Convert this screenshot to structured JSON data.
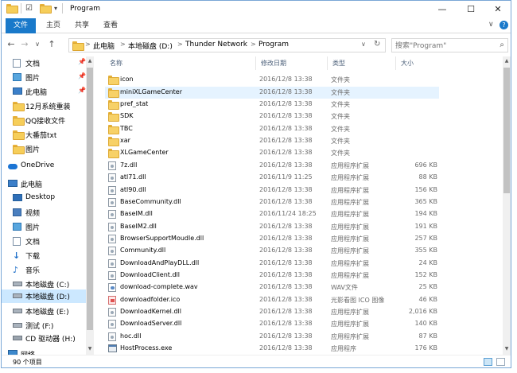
{
  "window": {
    "title": "Program",
    "controls": {
      "minimize": "—",
      "maximize": "☐",
      "close": "✕"
    }
  },
  "ribbon": {
    "tabs": [
      "文件",
      "主页",
      "共享",
      "查看"
    ],
    "expand_glyph": "∨",
    "help_glyph": "?"
  },
  "address": {
    "crumbs": [
      "此电脑",
      "本地磁盘 (D:)",
      "Thunder Network",
      "Program"
    ],
    "separator": ">",
    "refresh_glyph": "↻",
    "dropdown_glyph": "∨"
  },
  "search": {
    "placeholder": "搜索\"Program\"",
    "icon": "search-icon"
  },
  "nav_buttons": {
    "back": "←",
    "forward": "→",
    "recent": "∨",
    "up": "↑"
  },
  "navpane": {
    "items": [
      {
        "label": "文档",
        "icon": "document-icon",
        "pinned": true
      },
      {
        "label": "图片",
        "icon": "pictures-icon",
        "pinned": true
      },
      {
        "label": "此电脑",
        "icon": "computer-icon",
        "pinned": true
      },
      {
        "label": "12月系统重装",
        "icon": "folder-icon",
        "pinned": false
      },
      {
        "label": "QQ接收文件",
        "icon": "folder-icon",
        "pinned": false
      },
      {
        "label": "大番茄txt",
        "icon": "folder-icon",
        "pinned": false
      },
      {
        "label": "图片",
        "icon": "folder-icon",
        "pinned": false
      },
      {
        "label": "OneDrive",
        "icon": "onedrive-icon",
        "pinned": false
      },
      {
        "label": "此电脑",
        "icon": "computer-icon",
        "pinned": false
      },
      {
        "label": "Desktop",
        "icon": "desktop-icon",
        "pinned": false
      },
      {
        "label": "视频",
        "icon": "videos-icon",
        "pinned": false
      },
      {
        "label": "图片",
        "icon": "pictures-icon",
        "pinned": false
      },
      {
        "label": "文档",
        "icon": "document-icon",
        "pinned": false
      },
      {
        "label": "下载",
        "icon": "downloads-icon",
        "pinned": false
      },
      {
        "label": "音乐",
        "icon": "music-icon",
        "pinned": false
      },
      {
        "label": "本地磁盘 (C:)",
        "icon": "drive-icon",
        "pinned": false
      },
      {
        "label": "本地磁盘 (D:)",
        "icon": "drive-icon",
        "pinned": false,
        "selected": true
      },
      {
        "label": "本地磁盘 (E:)",
        "icon": "drive-icon",
        "pinned": false
      },
      {
        "label": "测试 (F:)",
        "icon": "drive-icon",
        "pinned": false
      },
      {
        "label": "CD 驱动器 (H:)",
        "icon": "cd-drive-icon",
        "pinned": false
      },
      {
        "label": "网络",
        "icon": "network-icon",
        "pinned": false
      }
    ]
  },
  "columns": {
    "name": "名称",
    "date": "修改日期",
    "type": "类型",
    "size": "大小"
  },
  "files": [
    {
      "name": "icon",
      "date": "2016/12/8 13:38",
      "type": "文件夹",
      "size": "",
      "kind": "folder"
    },
    {
      "name": "miniXLGameCenter",
      "date": "2016/12/8 13:38",
      "type": "文件夹",
      "size": "",
      "kind": "folder",
      "hover": true
    },
    {
      "name": "pref_stat",
      "date": "2016/12/8 13:38",
      "type": "文件夹",
      "size": "",
      "kind": "folder"
    },
    {
      "name": "SDK",
      "date": "2016/12/8 13:38",
      "type": "文件夹",
      "size": "",
      "kind": "folder"
    },
    {
      "name": "TBC",
      "date": "2016/12/8 13:38",
      "type": "文件夹",
      "size": "",
      "kind": "folder"
    },
    {
      "name": "xar",
      "date": "2016/12/8 13:38",
      "type": "文件夹",
      "size": "",
      "kind": "folder"
    },
    {
      "name": "XLGameCenter",
      "date": "2016/12/8 13:38",
      "type": "文件夹",
      "size": "",
      "kind": "folder"
    },
    {
      "name": "7z.dll",
      "date": "2016/12/8 13:38",
      "type": "应用程序扩展",
      "size": "696 KB",
      "kind": "dll"
    },
    {
      "name": "atl71.dll",
      "date": "2016/11/9 11:25",
      "type": "应用程序扩展",
      "size": "88 KB",
      "kind": "dll"
    },
    {
      "name": "atl90.dll",
      "date": "2016/12/8 13:38",
      "type": "应用程序扩展",
      "size": "156 KB",
      "kind": "dll"
    },
    {
      "name": "BaseCommunity.dll",
      "date": "2016/12/8 13:38",
      "type": "应用程序扩展",
      "size": "365 KB",
      "kind": "dll"
    },
    {
      "name": "BaseIM.dll",
      "date": "2016/11/24 18:25",
      "type": "应用程序扩展",
      "size": "194 KB",
      "kind": "dll"
    },
    {
      "name": "BaseIM2.dll",
      "date": "2016/12/8 13:38",
      "type": "应用程序扩展",
      "size": "191 KB",
      "kind": "dll"
    },
    {
      "name": "BrowserSupportMoudle.dll",
      "date": "2016/12/8 13:38",
      "type": "应用程序扩展",
      "size": "257 KB",
      "kind": "dll"
    },
    {
      "name": "Community.dll",
      "date": "2016/12/8 13:38",
      "type": "应用程序扩展",
      "size": "355 KB",
      "kind": "dll"
    },
    {
      "name": "DownloadAndPlayDLL.dll",
      "date": "2016/12/8 13:38",
      "type": "应用程序扩展",
      "size": "24 KB",
      "kind": "dll"
    },
    {
      "name": "DownloadClient.dll",
      "date": "2016/12/8 13:38",
      "type": "应用程序扩展",
      "size": "152 KB",
      "kind": "dll"
    },
    {
      "name": "download-complete.wav",
      "date": "2016/12/8 13:38",
      "type": "WAV文件",
      "size": "25 KB",
      "kind": "wav"
    },
    {
      "name": "downloadfolder.ico",
      "date": "2016/12/8 13:38",
      "type": "光影看图 ICO 图像",
      "size": "46 KB",
      "kind": "ico"
    },
    {
      "name": "DownloadKernel.dll",
      "date": "2016/12/8 13:38",
      "type": "应用程序扩展",
      "size": "2,016 KB",
      "kind": "dll"
    },
    {
      "name": "DownloadServer.dll",
      "date": "2016/12/8 13:38",
      "type": "应用程序扩展",
      "size": "140 KB",
      "kind": "dll"
    },
    {
      "name": "hoc.dll",
      "date": "2016/12/8 13:38",
      "type": "应用程序扩展",
      "size": "87 KB",
      "kind": "dll"
    },
    {
      "name": "HostProcess.exe",
      "date": "2016/12/8 13:38",
      "type": "应用程序",
      "size": "176 KB",
      "kind": "exe"
    }
  ],
  "status": {
    "count": "90 个项目"
  },
  "colors": {
    "accent": "#1979ca",
    "selection": "#cce8ff",
    "hover": "#e5f3ff"
  }
}
